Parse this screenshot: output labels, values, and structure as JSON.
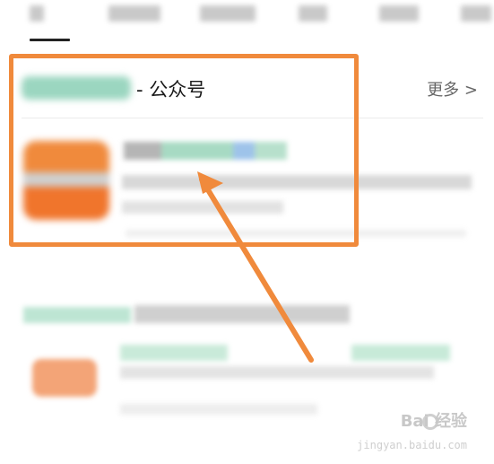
{
  "section": {
    "title": "- 公众号",
    "more_label": "更多 >"
  },
  "watermark": {
    "brand": "Bai 经验",
    "url": "jingyan.baidu.com"
  },
  "colors": {
    "accent_orange": "#f08a3c",
    "text_dark": "#1a1a1a",
    "text_muted": "#666666"
  },
  "icons": {
    "more": "chevron-right-icon",
    "watermark": "paw-icon"
  }
}
